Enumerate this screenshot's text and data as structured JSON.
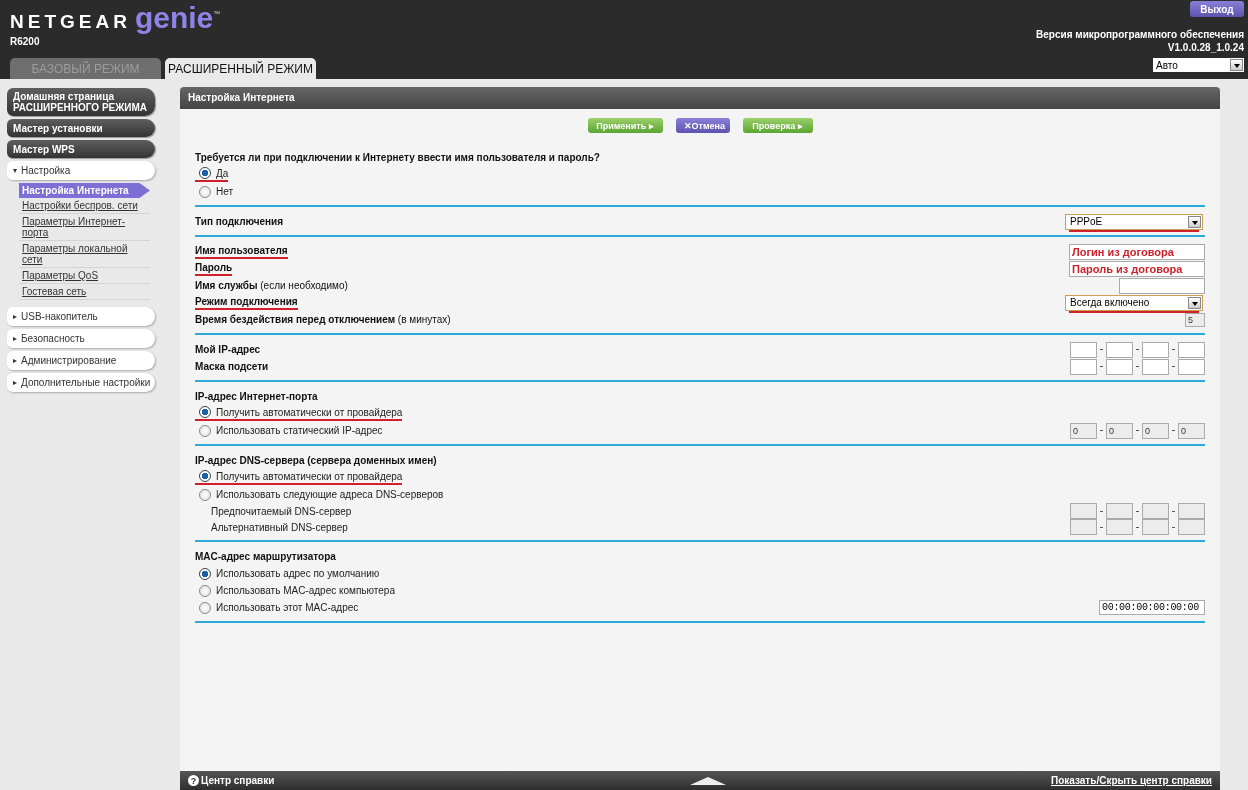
{
  "header": {
    "brand": "NETGEAR",
    "product": "genie",
    "trademark": "™",
    "model": "R6200",
    "logout": "Выход",
    "firmware_label": "Версия микропрограммного обеспечения",
    "firmware_version": "V1.0.0.28_1.0.24",
    "language": "Авто"
  },
  "tabs": [
    {
      "label": "БАЗОВЫЙ РЕЖИМ",
      "selected": false
    },
    {
      "label": "РАСШИРЕННЫЙ РЕЖИМ",
      "selected": true
    }
  ],
  "sidebar": [
    {
      "kind": "main",
      "label": "Домашняя страница РАСШИРЕННОГО РЕЖИМА"
    },
    {
      "kind": "main",
      "label": "Мастер установки"
    },
    {
      "kind": "main",
      "label": "Мастер WPS"
    },
    {
      "kind": "group",
      "label": "Настройка",
      "expanded": true,
      "children": [
        {
          "label": "Настройка Интернета",
          "selected": true
        },
        {
          "label": "Настройки беспров. сети",
          "selected": false
        },
        {
          "label": "Параметры Интернет-порта",
          "selected": false
        },
        {
          "label": "Параметры локальной сети",
          "selected": false
        },
        {
          "label": "Параметры QoS",
          "selected": false
        },
        {
          "label": "Гостевая сеть",
          "selected": false
        }
      ]
    },
    {
      "kind": "group",
      "label": "USB-накопитель",
      "expanded": false
    },
    {
      "kind": "group",
      "label": "Безопасность",
      "expanded": false
    },
    {
      "kind": "group",
      "label": "Администрирование",
      "expanded": false
    },
    {
      "kind": "group",
      "label": "Дополнительные настройки",
      "expanded": false
    }
  ],
  "panel": {
    "title": "Настройка Интернета",
    "buttons": [
      {
        "kind": "apply",
        "label": "Применить ▸"
      },
      {
        "kind": "cancel",
        "label": "✕Отмена"
      },
      {
        "kind": "test",
        "label": "Проверка ▸"
      }
    ],
    "sections": [
      {
        "rows": [
          {
            "kind": "heading",
            "text": "Требуется ли при подключении к Интернету ввести имя пользователя и пароль?"
          },
          {
            "kind": "radio",
            "label": "Да",
            "selected": true,
            "underlined": true
          },
          {
            "kind": "radio",
            "label": "Нет",
            "selected": false,
            "underlined": false
          }
        ]
      },
      {
        "rows": [
          {
            "kind": "field",
            "label": "Тип подключения",
            "underlined": false,
            "control": {
              "kind": "select",
              "value": "PPPoE",
              "underlined": true
            }
          }
        ]
      },
      {
        "rows": [
          {
            "kind": "field",
            "label": "Имя пользователя",
            "underlined": true,
            "control": {
              "kind": "text",
              "value": "Логин из договора",
              "disabled": false
            }
          },
          {
            "kind": "field",
            "label": "Пароль",
            "underlined": true,
            "control": {
              "kind": "text",
              "value": "Пароль из договора",
              "disabled": false
            }
          },
          {
            "kind": "field",
            "label": "**Имя службы** (если необходимо)",
            "underlined": false,
            "control": {
              "kind": "text",
              "disabled": false
            }
          },
          {
            "kind": "field",
            "label": "Режим подключения",
            "underlined": true,
            "control": {
              "kind": "select",
              "value": "Всегда включено",
              "underlined": true
            }
          },
          {
            "kind": "field",
            "label": "**Время бездействия перед отключением** (в минутах)",
            "underlined": false,
            "control": {
              "kind": "small",
              "value": "5",
              "disabled": true
            }
          }
        ]
      },
      {
        "rows": [
          {
            "kind": "field",
            "label": "Мой IP-адрес",
            "underlined": false,
            "control": {
              "kind": "ip",
              "disabled": false
            }
          },
          {
            "kind": "field",
            "label": "Маска подсети",
            "underlined": false,
            "control": {
              "kind": "ip",
              "disabled": false
            }
          }
        ]
      },
      {
        "rows": [
          {
            "kind": "heading",
            "text": "IP-адрес Интернет-порта"
          },
          {
            "kind": "radio",
            "label": "Получить автоматически от провайдера",
            "selected": true,
            "underlined": true
          },
          {
            "kind": "radio",
            "label": "Использовать статический IP-адрес",
            "selected": false,
            "underlined": false,
            "control": {
              "kind": "ip",
              "octets": [
                "0",
                "0",
                "0",
                "0"
              ],
              "disabled": true
            }
          }
        ]
      },
      {
        "rows": [
          {
            "kind": "heading",
            "text": "IP-адрес DNS-сервера (сервера доменных имен)"
          },
          {
            "kind": "radio",
            "label": "Получить автоматически от провайдера",
            "selected": true,
            "underlined": true
          },
          {
            "kind": "radio",
            "label": "Использовать следующие адреса DNS-серверов",
            "selected": false,
            "underlined": false
          },
          {
            "kind": "subfield",
            "label": "Предпочитаемый DNS-сервер",
            "control": {
              "kind": "ip",
              "disabled": true
            }
          },
          {
            "kind": "subfield",
            "label": "Альтернативный DNS-сервер",
            "control": {
              "kind": "ip",
              "disabled": true
            }
          }
        ]
      },
      {
        "rows": [
          {
            "kind": "heading",
            "text": "MAC-адрес маршрутизатора"
          },
          {
            "kind": "radio",
            "label": "Использовать адрес по умолчанию",
            "selected": true,
            "underlined": false
          },
          {
            "kind": "radio",
            "label": "Использовать MAC-адрес компьютера",
            "selected": false,
            "underlined": false
          },
          {
            "kind": "radio",
            "label": "Использовать этот MAC-адрес",
            "selected": false,
            "underlined": false,
            "control": {
              "kind": "mac",
              "value": "00:00:00:00:00:00",
              "disabled": false
            }
          }
        ]
      }
    ]
  },
  "footer": {
    "help_icon": "?",
    "help": "Центр справки",
    "toggle": "Показать/Скрыть центр справки"
  }
}
